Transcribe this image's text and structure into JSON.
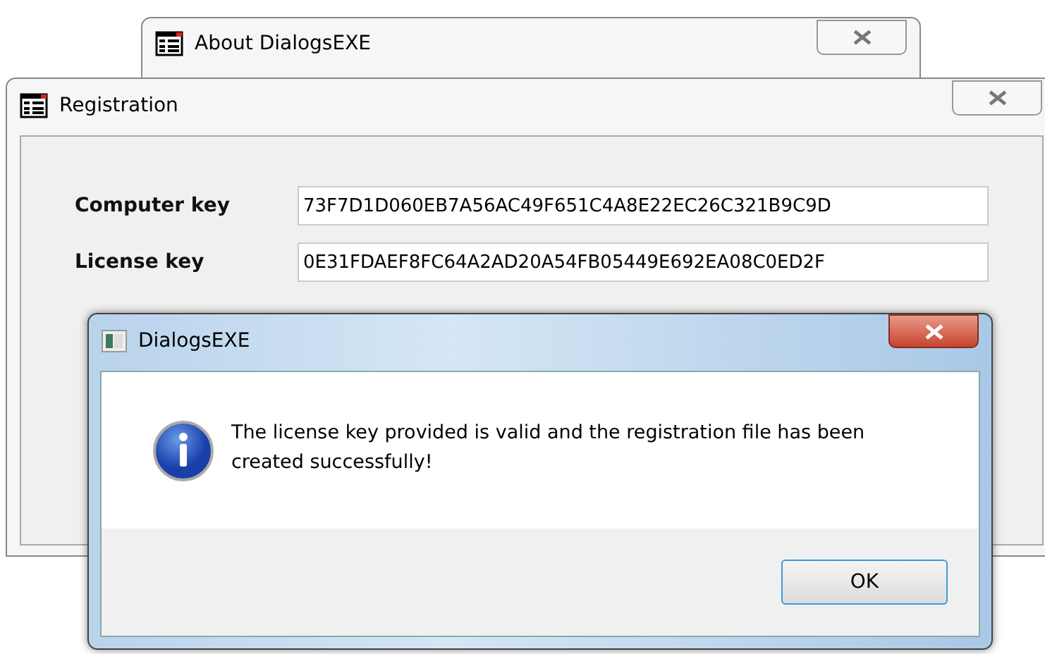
{
  "background_window": {
    "title": "About DialogsEXE"
  },
  "registration_window": {
    "title": "Registration",
    "fields": [
      {
        "label": "Computer key",
        "value": "73F7D1D060EB7A56AC49F651C4A8E22EC26C321B9C9D"
      },
      {
        "label": "License key",
        "value": "0E31FDAEF8FC64A2AD20A54FB05449E692EA08C0ED2F"
      }
    ]
  },
  "message_dialog": {
    "title": "DialogsEXE",
    "kind": "info",
    "message": "The license key provided is valid and the registration file has been created successfully!",
    "buttons": [
      "OK"
    ]
  }
}
